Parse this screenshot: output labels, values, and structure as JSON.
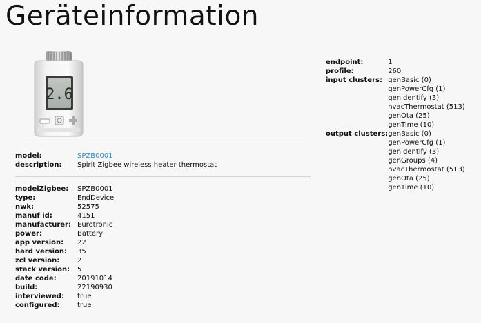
{
  "page": {
    "title": "Geräteinformation"
  },
  "model_section": {
    "model_label": "model:",
    "model_value": "SPZB0001",
    "description_label": "description:",
    "description_value": "Spirit Zigbee wireless heater thermostat"
  },
  "zigbee_section": {
    "rows": [
      {
        "label": "modelZigbee:",
        "value": "SPZB0001"
      },
      {
        "label": "type:",
        "value": "EndDevice"
      },
      {
        "label": "nwk:",
        "value": "52575"
      },
      {
        "label": "manuf id:",
        "value": "4151"
      },
      {
        "label": "manufacturer:",
        "value": "Eurotronic"
      },
      {
        "label": "power:",
        "value": "Battery"
      },
      {
        "label": "app version:",
        "value": "22"
      },
      {
        "label": "hard version:",
        "value": "35"
      },
      {
        "label": "zcl version:",
        "value": "2"
      },
      {
        "label": "stack version:",
        "value": "5"
      },
      {
        "label": "date code:",
        "value": "20191014"
      },
      {
        "label": "build:",
        "value": "22190930"
      },
      {
        "label": "interviewed:",
        "value": "true"
      },
      {
        "label": "configured:",
        "value": "true"
      }
    ]
  },
  "endpoint_section": {
    "endpoint_label": "endpoint:",
    "endpoint_value": "1",
    "profile_label": "profile:",
    "profile_value": "260",
    "input_label": "input clusters:",
    "input_clusters": [
      "genBasic (0)",
      "genPowerCfg (1)",
      "genIdentify (3)",
      "hvacThermostat (513)",
      "genOta (25)",
      "genTime (10)"
    ],
    "output_label": "output clusters:",
    "output_clusters": [
      "genBasic (0)",
      "genPowerCfg (1)",
      "genIdentify (3)",
      "genGroups (4)",
      "hvacThermostat (513)",
      "genOta (25)",
      "genTime (10)"
    ]
  },
  "device_image": {
    "display_digits": "2.6"
  }
}
